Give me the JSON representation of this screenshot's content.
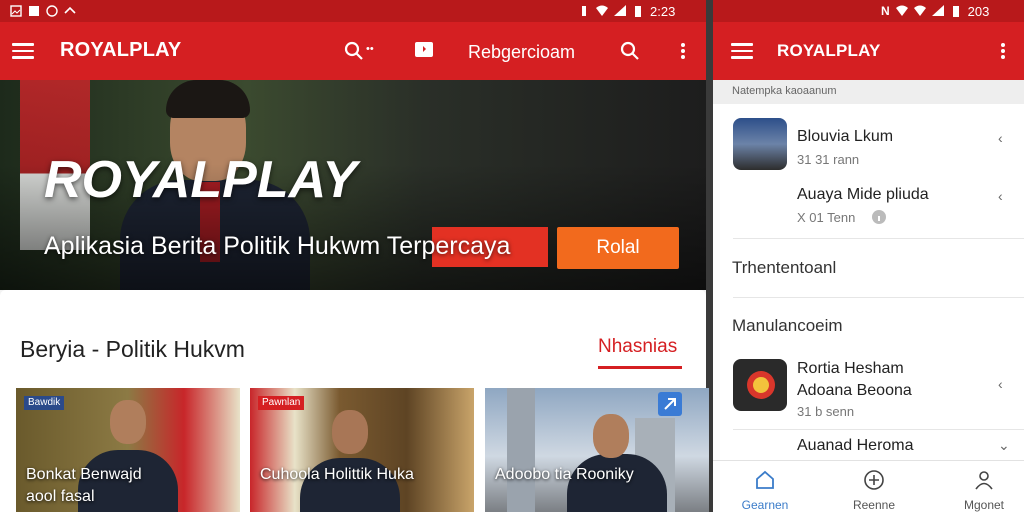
{
  "left": {
    "status": {
      "time": "2:23"
    },
    "appbar": {
      "title": "ROYALPLAY",
      "search_label": "••",
      "section_label": "Rebgercioam"
    },
    "hero": {
      "brand": "ROYALPLAY",
      "subtitle": "Aplikasia Berita Politik Hukwm Terpercaya",
      "button_label": "Rolal"
    },
    "section": {
      "title": "Beryia - Politik Hukvm",
      "more_label": "Nhasnias"
    },
    "thumbs": [
      {
        "badge": "Bawdik",
        "caption_1": "Bonkat Benwajd",
        "caption_2": "aool fasal"
      },
      {
        "badge": "Pawnlan",
        "caption_1": "Cuhoola Holittik Huka",
        "caption_2": ""
      },
      {
        "badge": "",
        "caption_1": "Adoobo tia Rooniky",
        "caption_2": ""
      }
    ]
  },
  "right": {
    "status": {
      "time": "203"
    },
    "appbar": {
      "title": "ROYALPLAY"
    },
    "subheader": "Natempka kaoaanum",
    "items": [
      {
        "title": "Blouvia Lkum",
        "meta": "31 31 rann"
      },
      {
        "title": "Auaya Mide pliuda",
        "meta": "X 01 Tenn"
      }
    ],
    "section_1": "Trhententoanl",
    "section_2": "Manulancoeim",
    "items_2": [
      {
        "title": "Rortia Hesham",
        "title_2": "Adoana Beoona",
        "meta": "31 b senn"
      },
      {
        "title": "Auanad Heroma",
        "title_2": "",
        "meta": ""
      }
    ],
    "bottom_nav": [
      {
        "label": "Gearnen",
        "icon": "home-icon"
      },
      {
        "label": "Reenne",
        "icon": "plus-circle-icon"
      },
      {
        "label": "Mgonet",
        "icon": "profile-icon"
      }
    ]
  },
  "colors": {
    "primary": "#d51f22",
    "status_bar": "#b8191b",
    "accent_orange": "#f26a1d",
    "nav_active": "#3b7cc9"
  }
}
